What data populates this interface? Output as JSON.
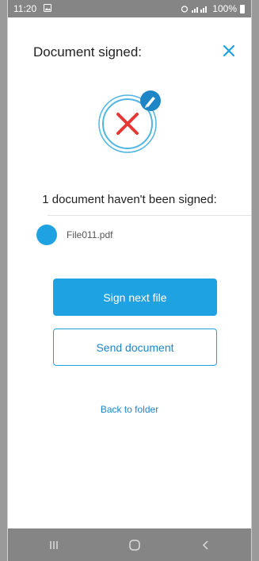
{
  "status_bar": {
    "time": "11:20",
    "battery": "100%",
    "icons": [
      "image-icon",
      "alarm-icon",
      "signal-icon",
      "battery-icon"
    ]
  },
  "header": {
    "title": "Document signed:",
    "close_icon": "close-icon"
  },
  "status": {
    "icon": "signature-failed-icon",
    "message": "1 document haven't been signed:"
  },
  "files": [
    {
      "name": "File011.pdf"
    }
  ],
  "actions": {
    "sign_next": "Sign next file",
    "send": "Send document",
    "back": "Back to folder"
  },
  "navbar": {
    "icons": [
      "recent-apps-icon",
      "home-icon",
      "back-icon"
    ]
  },
  "colors": {
    "accent": "#1ea2e1",
    "error": "#e53935",
    "system_bar": "#858585"
  }
}
